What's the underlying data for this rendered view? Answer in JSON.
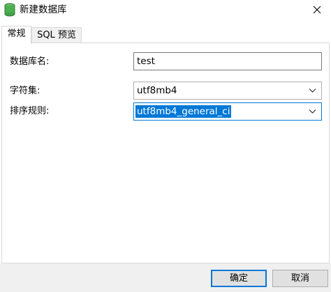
{
  "window": {
    "title": "新建数据库",
    "icon": "database-icon",
    "close_icon": "close-icon"
  },
  "tabs": [
    {
      "label": "常规",
      "active": true
    },
    {
      "label": "SQL 预览",
      "active": false
    }
  ],
  "form": {
    "database_name": {
      "label": "数据库名:",
      "value": "test"
    },
    "charset": {
      "label": "字符集:",
      "value": "utf8mb4"
    },
    "collation": {
      "label": "排序规则:",
      "value": "utf8mb4_general_ci"
    }
  },
  "buttons": {
    "ok": "确定",
    "cancel": "取消"
  },
  "colors": {
    "accent": "#0078d7",
    "icon_green": "#4caf50",
    "bottom_bar": "#f0f0f0"
  }
}
